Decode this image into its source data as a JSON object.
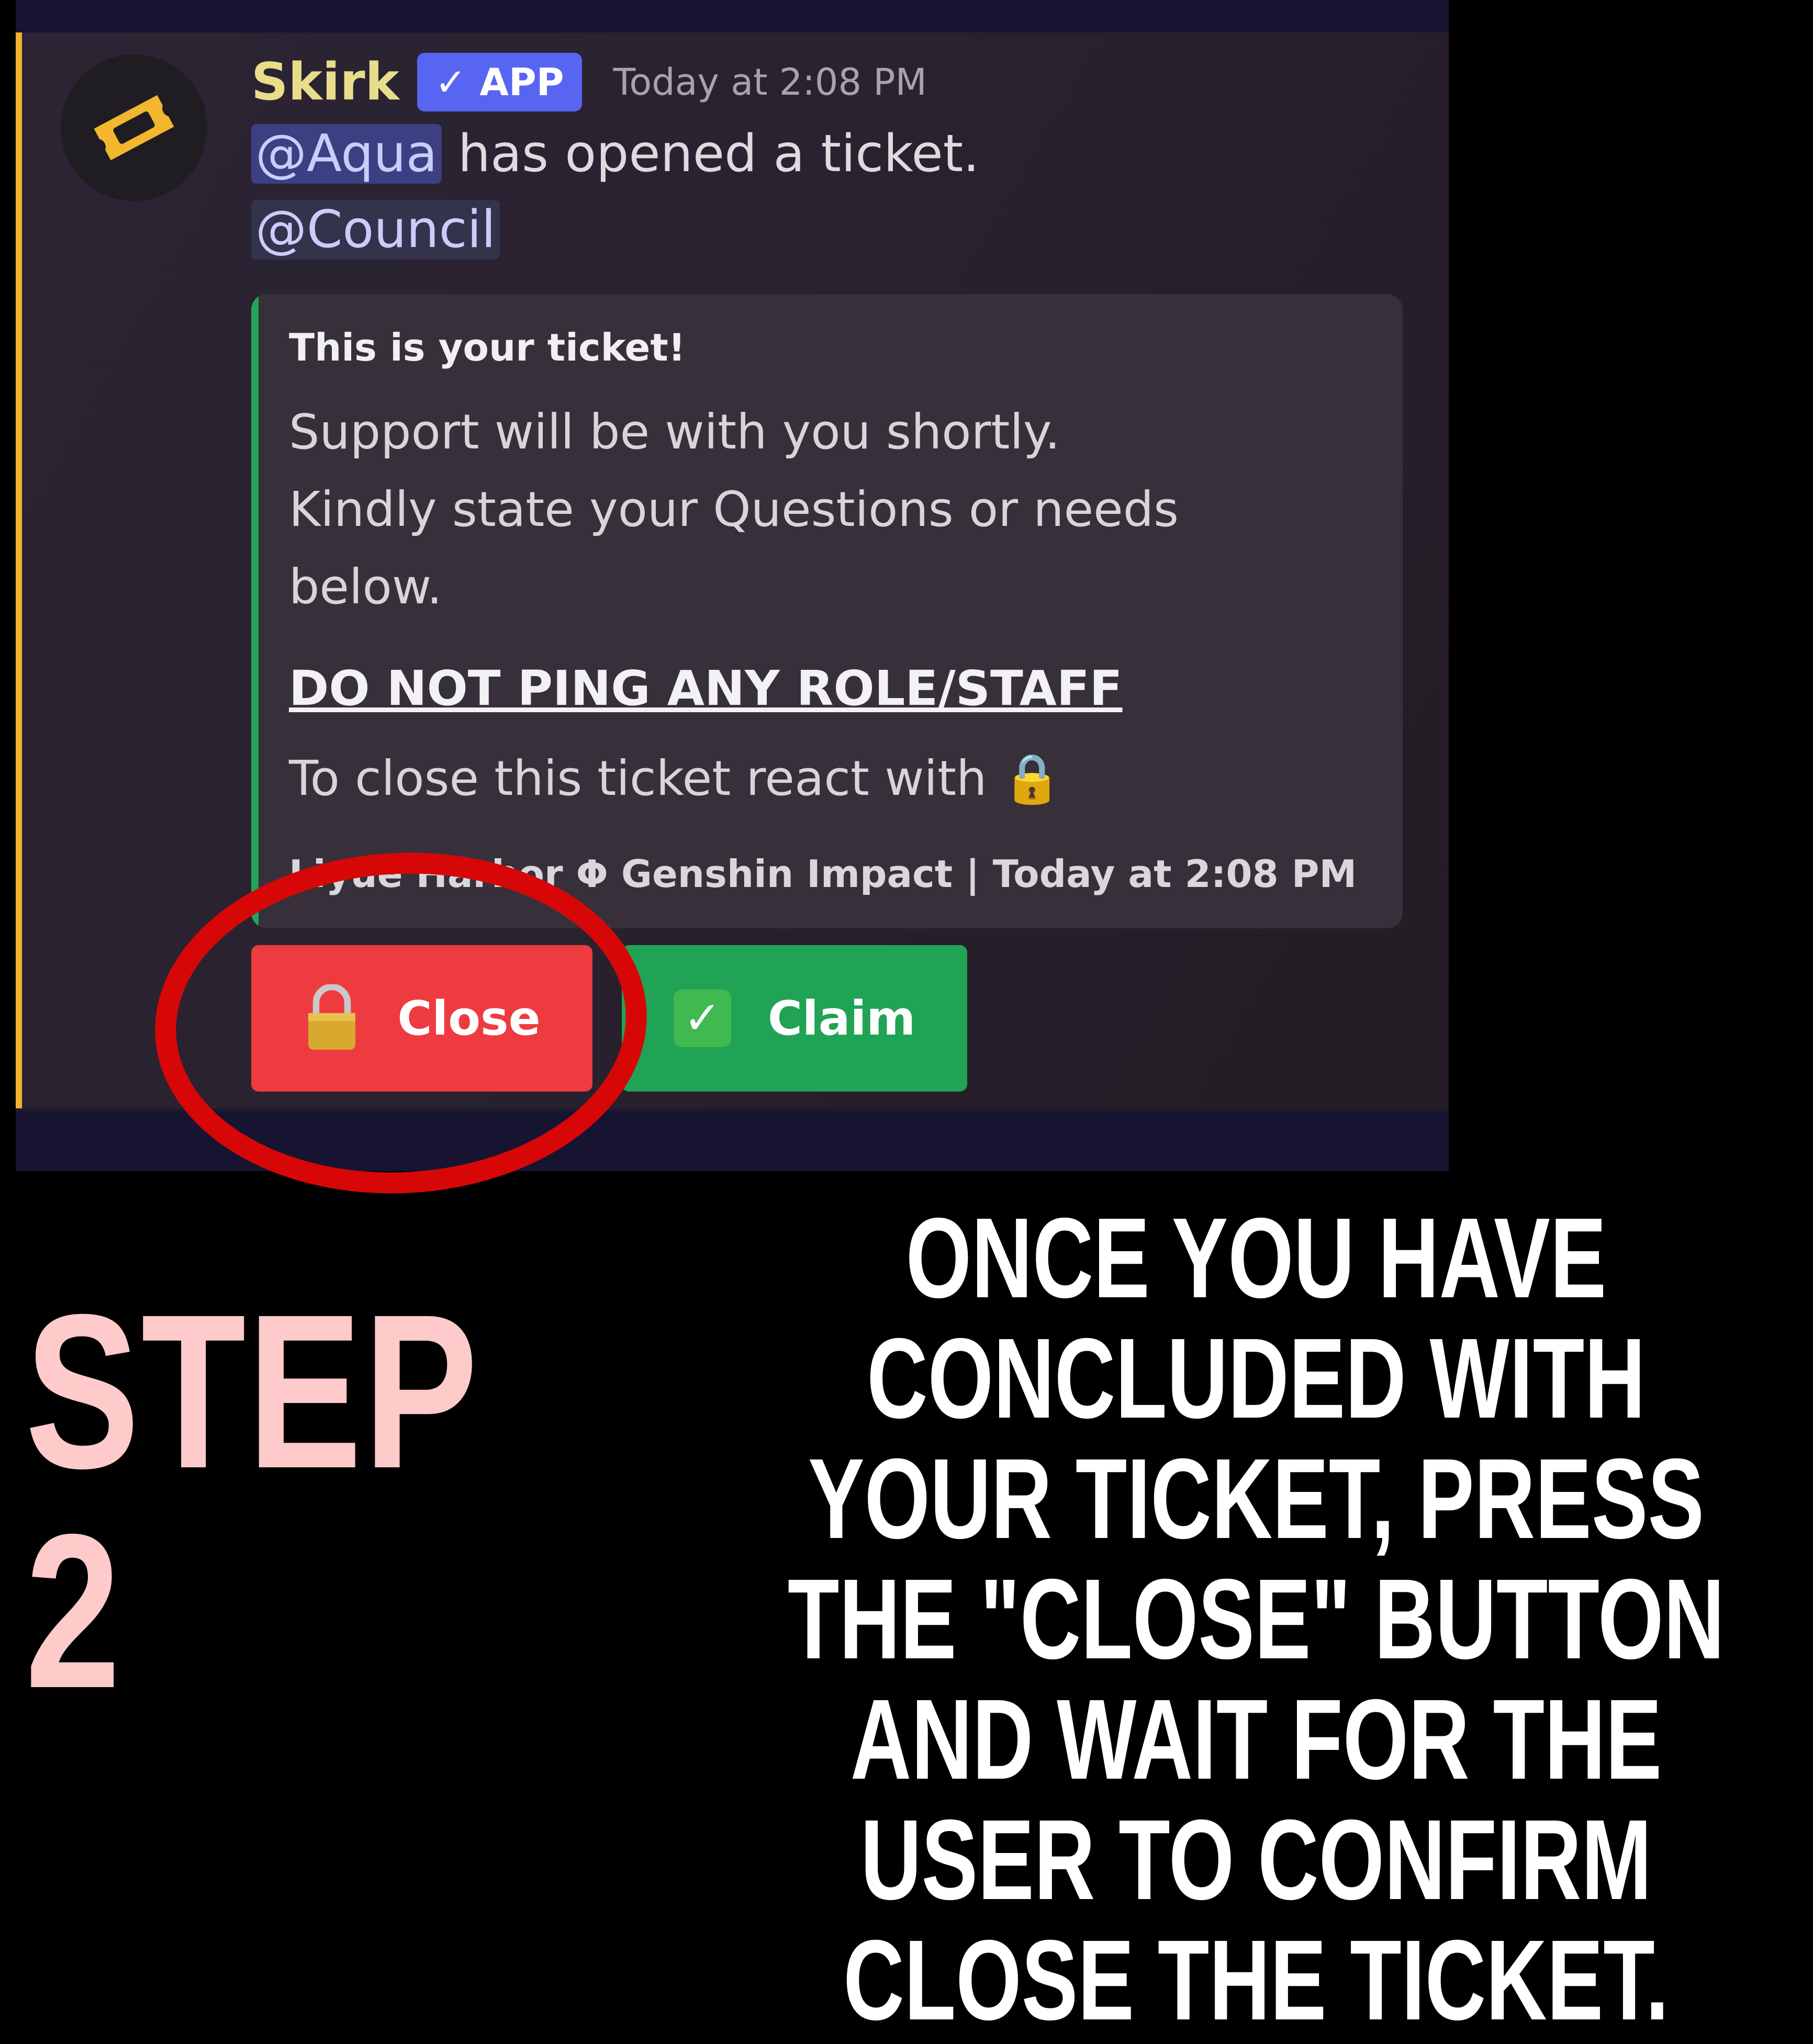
{
  "message": {
    "username": "Skirk",
    "badge": "✓ APP",
    "timestamp": "Today at 2:08 PM",
    "mention_user": "@Aqua",
    "opened_text": " has opened a ticket.",
    "mention_role": "@Council",
    "avatar_icon": "ticket-icon"
  },
  "embed": {
    "title": "This is your ticket!",
    "line1": "Support will be with you shortly.",
    "line2": "Kindly state your Questions or needs",
    "line3": "below.",
    "warning": "DO NOT PING ANY ROLE/STAFF",
    "close_hint": "To close this ticket react with",
    "close_emoji": "🔒",
    "footer": "Liyue Harbor Φ Genshin Impact | Today at 2:08 PM",
    "accent_color": "#23a55a"
  },
  "buttons": {
    "close_label": "Close",
    "close_icon": "lock-icon",
    "claim_label": "Claim",
    "claim_icon": "check-icon",
    "close_color": "#ee3b40",
    "claim_color": "#20a354"
  },
  "overlay": {
    "step": "STEP 2",
    "instructions": "ONCE YOU HAVE CONCLUDED WITH YOUR TICKET, PRESS THE \"CLOSE\" BUTTON AND WAIT FOR THE USER TO CONFIRM CLOSE THE TICKET.",
    "highlight_color": "#d80707"
  }
}
